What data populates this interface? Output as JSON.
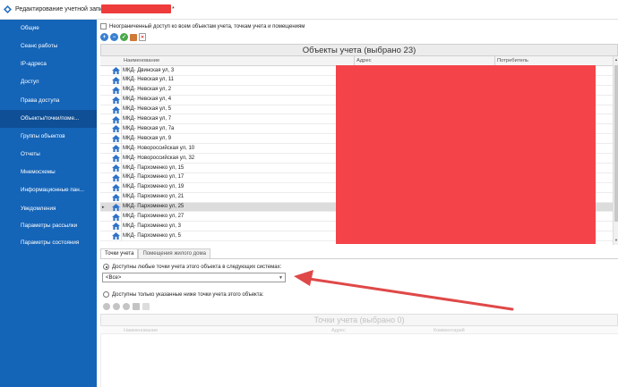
{
  "window": {
    "title": "Редактирование учетной записи:",
    "title_suffix": "*"
  },
  "sidebar": {
    "items": [
      {
        "label": "Общие"
      },
      {
        "label": "Сеанс работы"
      },
      {
        "label": "IP-адреса"
      },
      {
        "label": "Доступ"
      },
      {
        "label": "Права доступа"
      },
      {
        "label": "Объекты/точки/поме..."
      },
      {
        "label": "Группы объектов"
      },
      {
        "label": "Отчеты"
      },
      {
        "label": "Мнемосхемы"
      },
      {
        "label": "Информационные пан..."
      },
      {
        "label": "Уведомления"
      },
      {
        "label": "Параметры рассылки"
      },
      {
        "label": "Параметры состояния"
      }
    ],
    "active_index": 5
  },
  "main": {
    "unlimited_access_label": "Неограниченный доступ ко всем объектам учета, точкам учета и помещениям",
    "grid": {
      "title": "Объекты учета (выбрано 23)",
      "columns": [
        "Наименование",
        "Адрес",
        "Потребитель"
      ],
      "rows": [
        "МКД- Двинская ул, 3",
        "МКД- Невская ул, 11",
        "МКД- Невская ул, 2",
        "МКД- Невская ул, 4",
        "МКД- Невская ул, 5",
        "МКД- Невская ул, 7",
        "МКД- Невская ул, 7а",
        "МКД- Невская ул, 9",
        "МКД- Новороссийская ул, 10",
        "МКД- Новороссийская ул, 32",
        "МКД- Пархоменко ул, 15",
        "МКД- Пархоменко ул, 17",
        "МКД- Пархоменко ул, 19",
        "МКД- Пархоменко ул, 21",
        "МКД- Пархоменко ул, 25",
        "МКД- Пархоменко ул, 27",
        "МКД- Пархоменко ул, 3",
        "МКД- Пархоменко ул, 5"
      ],
      "selected_index": 14,
      "row_marker": "▸"
    },
    "tabs": [
      {
        "label": "Точки учета"
      },
      {
        "label": "Помещения жилого дома"
      }
    ],
    "active_tab": 0,
    "radio_all_label": "Доступны любые точки учета этого объекта в следующих системах:",
    "systems_select_value": "<Все>",
    "radio_specific_label": "Доступны только указанные ниже точки учета этого объекта:",
    "points_grid": {
      "title": "Точки учета (выбрано 0)",
      "columns": [
        "Наименование",
        "Адрес",
        "Комментарий"
      ]
    }
  },
  "colors": {
    "sidebar_bg": "#1464b8",
    "sidebar_active": "#0e4f96",
    "redaction": "#f4444a",
    "annotation_arrow": "#e04848"
  },
  "icons": {
    "row_icon": "house-icon",
    "toolbar": [
      "add-icon",
      "remove-icon",
      "check-icon",
      "edit-icon",
      "clear-icon"
    ]
  }
}
